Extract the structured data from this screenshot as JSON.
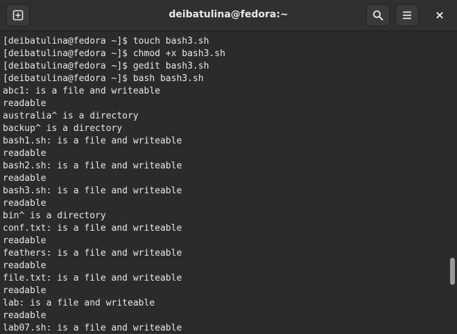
{
  "window": {
    "title": "deibatulina@fedora:~"
  },
  "toolbar": {
    "new_tab_icon": "plus-in-square-icon",
    "search_icon": "magnifier-icon",
    "menu_icon": "hamburger-icon",
    "close_icon": "x-icon"
  },
  "terminal": {
    "lines": [
      "[deibatulina@fedora ~]$ touch bash3.sh",
      "[deibatulina@fedora ~]$ chmod +x bash3.sh",
      "[deibatulina@fedora ~]$ gedit bash3.sh",
      "[deibatulina@fedora ~]$ bash bash3.sh",
      "abc1: is a file and writeable",
      "readable",
      "australia^ is a directory",
      "backup^ is a directory",
      "bash1.sh: is a file and writeable",
      "readable",
      "bash2.sh: is a file and writeable",
      "readable",
      "bash3.sh: is a file and writeable",
      "readable",
      "bin^ is a directory",
      "conf.txt: is a file and writeable",
      "readable",
      "feathers: is a file and writeable",
      "readable",
      "file.txt: is a file and writeable",
      "readable",
      "lab: is a file and writeable",
      "readable",
      "lab07.sh: is a file and writeable"
    ]
  },
  "colors": {
    "background": "#2b2b2b",
    "titlebar": "#303030",
    "text": "#e8e8e8",
    "scroll_thumb": "#9a9a9a"
  }
}
